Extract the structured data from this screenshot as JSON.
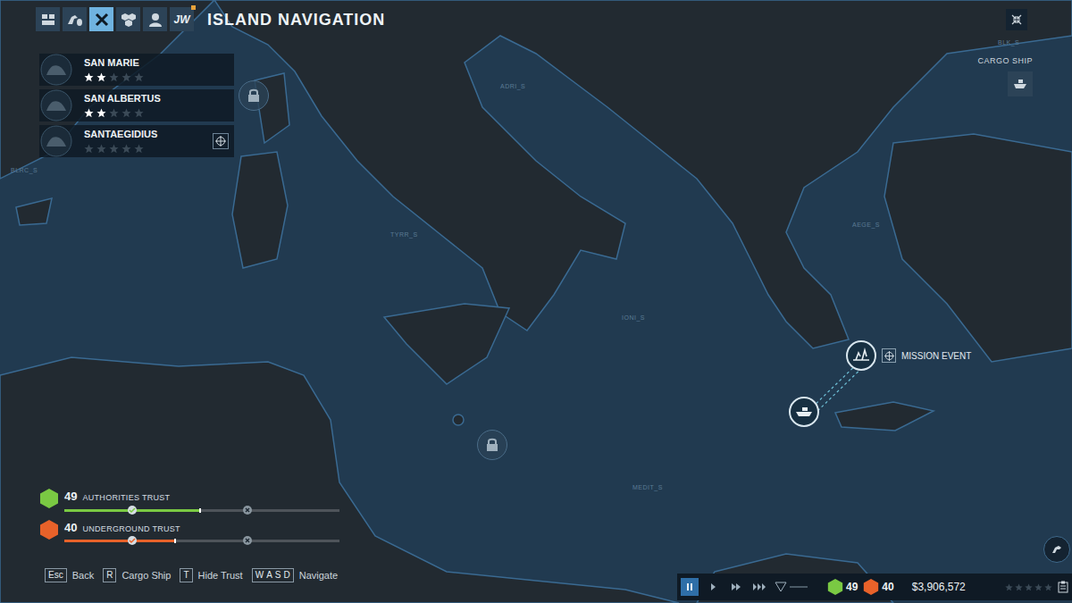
{
  "header": {
    "title": "ISLAND NAVIGATION",
    "tabs": [
      {
        "kind": "icon",
        "selected": false
      },
      {
        "kind": "icon",
        "selected": false
      },
      {
        "kind": "icon",
        "selected": true
      },
      {
        "kind": "icon",
        "selected": false
      },
      {
        "kind": "icon",
        "selected": false
      },
      {
        "kind": "logo",
        "label": "JW",
        "selected": false
      }
    ]
  },
  "islands": [
    {
      "name": "SAN MARIE",
      "stars": 2,
      "targeted": false
    },
    {
      "name": "SAN ALBERTUS",
      "stars": 2,
      "targeted": false
    },
    {
      "name": "SANTAEGIDIUS",
      "stars": 0,
      "targeted": true
    }
  ],
  "cargo_ship": {
    "label": "CARGO SHIP"
  },
  "map": {
    "labels": [
      {
        "text": "ADRI_S"
      },
      {
        "text": "TYRR_S"
      },
      {
        "text": "IONI_S"
      },
      {
        "text": "AEGE_S"
      },
      {
        "text": "BLK_S"
      },
      {
        "text": "BLRC_S"
      },
      {
        "text": "MEDIT_S"
      }
    ],
    "pins": [
      {
        "kind": "locked"
      },
      {
        "kind": "locked"
      },
      {
        "kind": "mission",
        "label": "MISSION EVENT"
      },
      {
        "kind": "ship"
      }
    ]
  },
  "trust": [
    {
      "value": "49",
      "label": "AUTHORITIES TRUST",
      "level": 0.49,
      "color": "#7ac943"
    },
    {
      "value": "40",
      "label": "UNDERGROUND TRUST",
      "level": 0.4,
      "color": "#e8622a"
    }
  ],
  "hotkeys": [
    {
      "keys": [
        "Esc"
      ],
      "action": "Back"
    },
    {
      "keys": [
        "R"
      ],
      "action": "Cargo Ship"
    },
    {
      "keys": [
        "T"
      ],
      "action": "Hide Trust"
    },
    {
      "keys": [
        "W",
        "A",
        "S",
        "D"
      ],
      "action": "Navigate"
    }
  ],
  "status_bar": {
    "speeds": [
      {
        "selected": true
      },
      {
        "selected": false
      },
      {
        "selected": false
      },
      {
        "selected": false
      }
    ],
    "authorities": "49",
    "underground": "40",
    "money": "$3,906,572",
    "stars": 0
  }
}
